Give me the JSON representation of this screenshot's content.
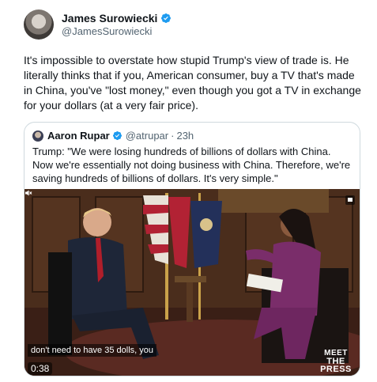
{
  "author": {
    "display_name": "James Surowiecki",
    "handle": "@JamesSurowiecki",
    "verified": true,
    "verified_color": "#1d9bf0"
  },
  "tweet": {
    "text": "It's impossible to overstate how stupid Trump's view of trade is. He literally thinks that if you, American consumer, buy a TV that's made in China, you've \"lost money,\" even though you got a TV in exchange for your dollars (at a very fair price)."
  },
  "quoted": {
    "display_name": "Aaron Rupar",
    "handle": "@atrupar",
    "separator": "·",
    "time": "23h",
    "text": "Trump: \"We were losing hundreds of billions of dollars with China. Now we're essentially not doing business with China. Therefore, we're saving hundreds of billions of dollars. It's very simple.\"",
    "video": {
      "caption": "don't need to have 35 dolls, you",
      "timestamp": "0:38",
      "logo_line1": "MEET",
      "logo_line2": "THE PRESS",
      "mute_icon": "speaker-muted-icon",
      "expand_icon": "expand-icon"
    }
  }
}
